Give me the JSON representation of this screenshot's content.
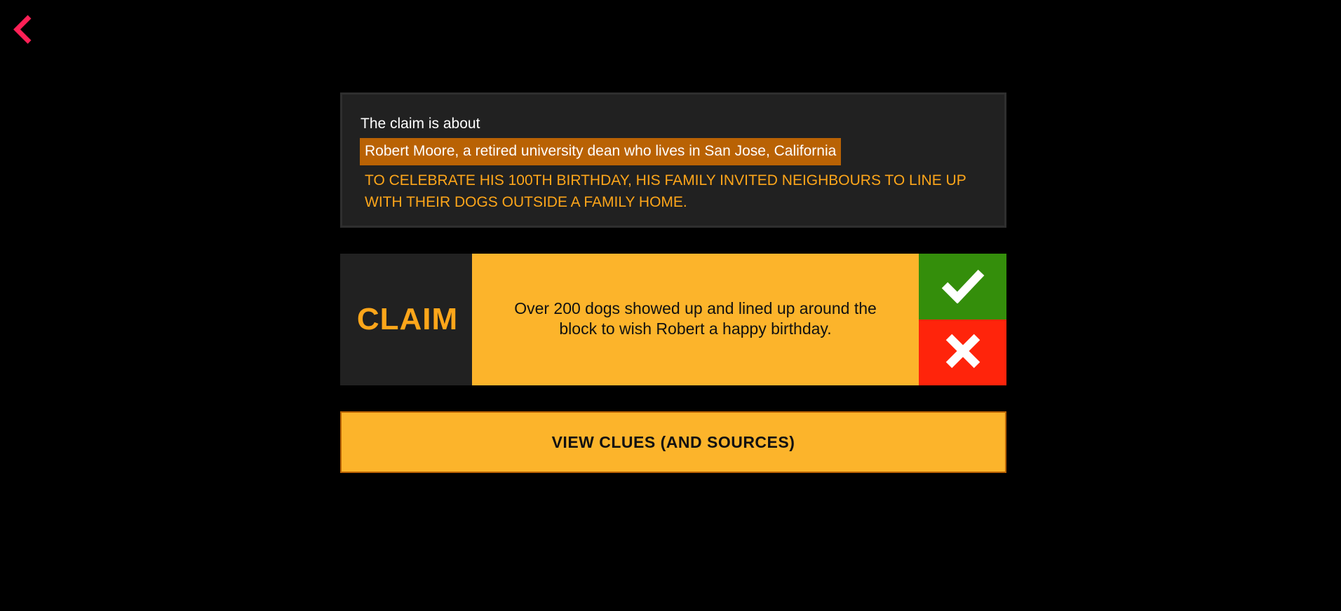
{
  "nav": {
    "back_icon": "chevron-left-icon",
    "back_color": "#ff2056"
  },
  "context": {
    "intro": "The claim is about",
    "subject": "Robert Moore, a retired university dean who lives in San Jose, California",
    "detail": "To celebrate his 100th birthday, his family invited neighbours to line up with their dogs outside a family home."
  },
  "claim": {
    "label": "CLAIM",
    "text": "Over 200 dogs showed up and lined up around the block to wish Robert a happy birthday.",
    "true_icon": "checkmark-icon",
    "false_icon": "cross-icon"
  },
  "actions": {
    "view_clues_label": "VIEW CLUES (AND SOURCES)"
  },
  "colors": {
    "accent_orange": "#fea61a",
    "highlight": "#b96204",
    "claim_bg": "#fcb42b",
    "true_green": "#348e0b",
    "false_red": "#ff240b",
    "panel_dark": "#212121"
  }
}
